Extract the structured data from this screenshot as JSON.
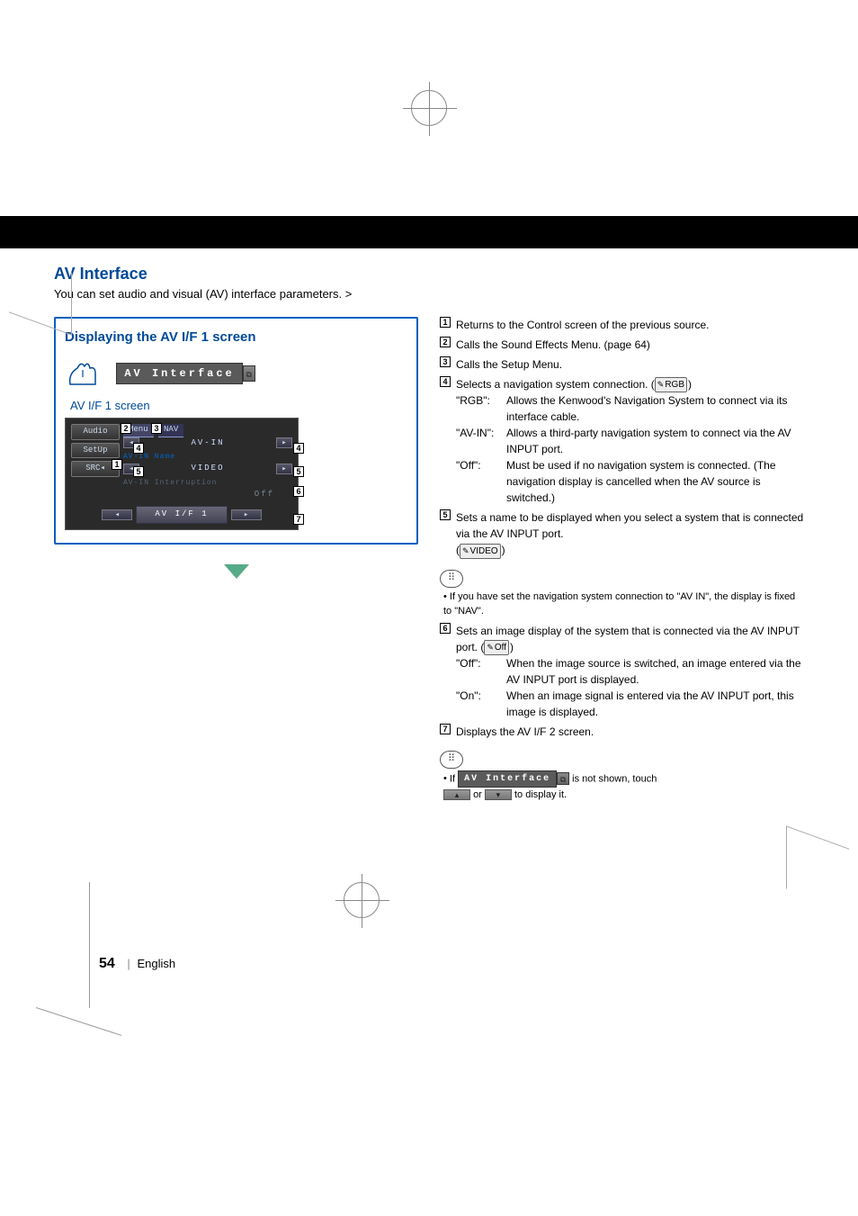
{
  "page": {
    "number": "54",
    "language_label": "English"
  },
  "section": {
    "title": "AV Interface",
    "intro": "You can set audio and visual (AV) interface parameters. >"
  },
  "box": {
    "title": "Displaying the AV I/F 1 screen",
    "banner_text": "AV Interface",
    "banner_cap": "⧉",
    "screenshot_label": "AV I/F 1 screen"
  },
  "ui": {
    "left_buttons": [
      "Audio",
      "SetUp",
      "SRC"
    ],
    "menu_label": "Menu",
    "tab": "NAV",
    "rows": [
      {
        "label": "",
        "value": "AV-IN",
        "callout_left": "4",
        "callout_right": "4"
      },
      {
        "label": "AV-IN Name",
        "value": "VIDEO",
        "callout_left": "5",
        "callout_right": "5"
      },
      {
        "label": "AV-IN Interruption",
        "value": "Off",
        "callout_right": "6"
      }
    ],
    "page_indicator": "AV I/F 1",
    "page_callout": "7",
    "top_callout_2": "2",
    "top_callout_3": "3",
    "src_callout": "1"
  },
  "items": {
    "i1": "Returns to the Control screen of the previous source.",
    "i2": "Calls the Sound Effects Menu. (page 64)",
    "i3": "Calls the Setup Menu.",
    "i4": {
      "lead": "Selects a navigation system connection. (",
      "default": "RGB",
      "close": ")",
      "opts": [
        {
          "k": "\"RGB\":",
          "v": "Allows the Kenwood's Navigation System to connect via its interface cable."
        },
        {
          "k": "\"AV-IN\":",
          "v": "Allows a third-party navigation system to connect via the AV INPUT port."
        },
        {
          "k": "\"Off\":",
          "v": "Must be used if no navigation system is connected. (The navigation display is cancelled when the AV source is switched.)"
        }
      ]
    },
    "i5": {
      "lead": "Sets a name to be displayed when you select a system that is connected via the AV INPUT port.",
      "default": "VIDEO"
    },
    "note1": "If you have set the navigation system connection to \"AV IN\", the display is fixed to \"NAV\".",
    "i6": {
      "lead": "Sets an image display of the system that is connected via the AV INPUT port. (",
      "default": "Off",
      "close": ")",
      "opts": [
        {
          "k": "\"Off\":",
          "v": "When the image source is switched, an image entered via the AV INPUT port is displayed."
        },
        {
          "k": "\"On\":",
          "v": "When an image signal is entered via the AV INPUT port, this image is displayed."
        }
      ]
    },
    "i7": "Displays the AV I/F 2 screen.",
    "note2": {
      "pre": "If ",
      "banner": "AV Interface",
      "mid": " is not shown, touch ",
      "or": " or ",
      "post": " to display it."
    }
  }
}
